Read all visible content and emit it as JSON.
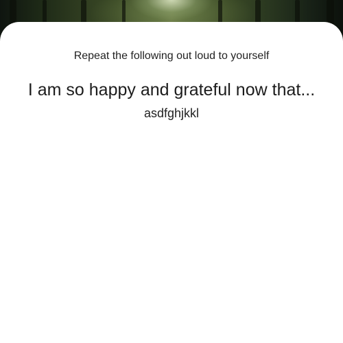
{
  "header_image": {
    "icon": "forest-path-image"
  },
  "sheet": {
    "instruction": "Repeat the following out loud to yourself",
    "affirmation": "I am so happy and grateful now that...",
    "user_text": "asdfghjkkl"
  }
}
